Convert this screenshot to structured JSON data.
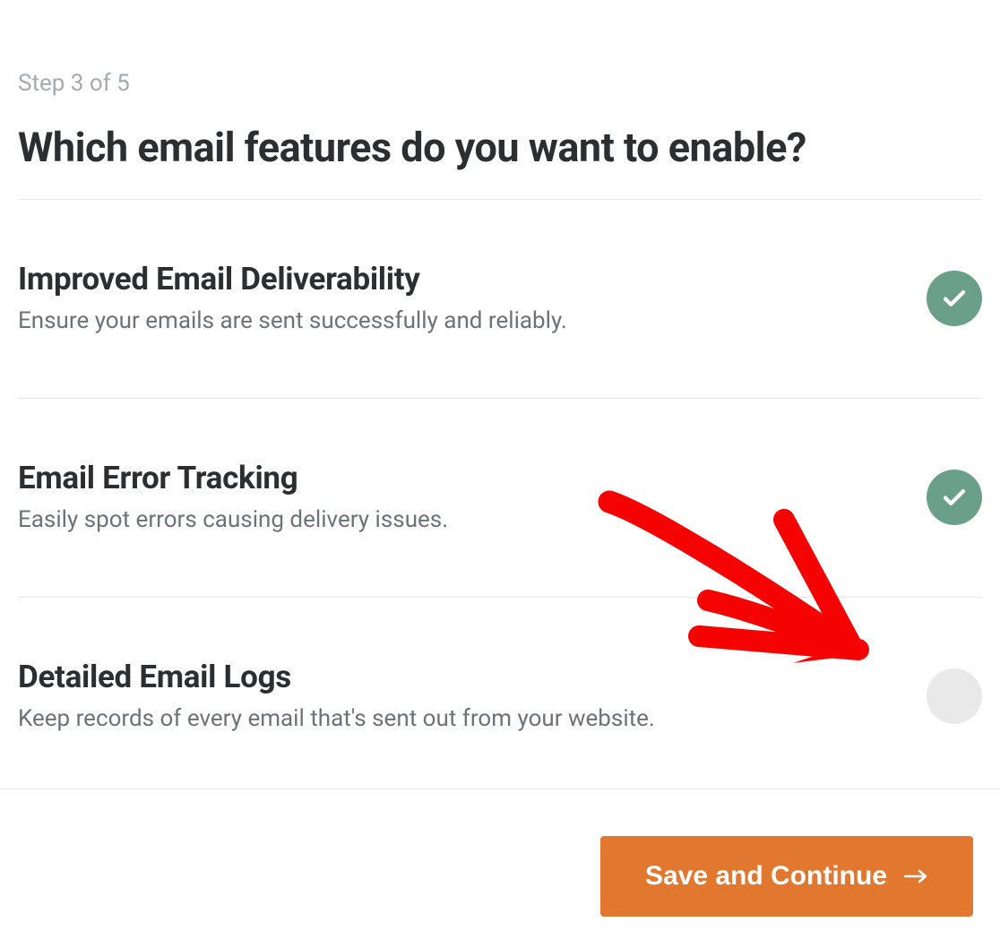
{
  "step": "Step 3 of 5",
  "heading": "Which email features do you want to enable?",
  "features": [
    {
      "title": "Improved Email Deliverability",
      "desc": "Ensure your emails are sent successfully and reliably.",
      "enabled": true
    },
    {
      "title": "Email Error Tracking",
      "desc": "Easily spot errors causing delivery issues.",
      "enabled": true
    },
    {
      "title": "Detailed Email Logs",
      "desc": "Keep records of every email that's sent out from your website.",
      "enabled": false
    }
  ],
  "button": {
    "label": "Save and Continue"
  },
  "colors": {
    "accent": "#e27730",
    "toggle_on": "#6aa08b",
    "toggle_off": "#e9e9ea",
    "annotation": "#f50202"
  }
}
